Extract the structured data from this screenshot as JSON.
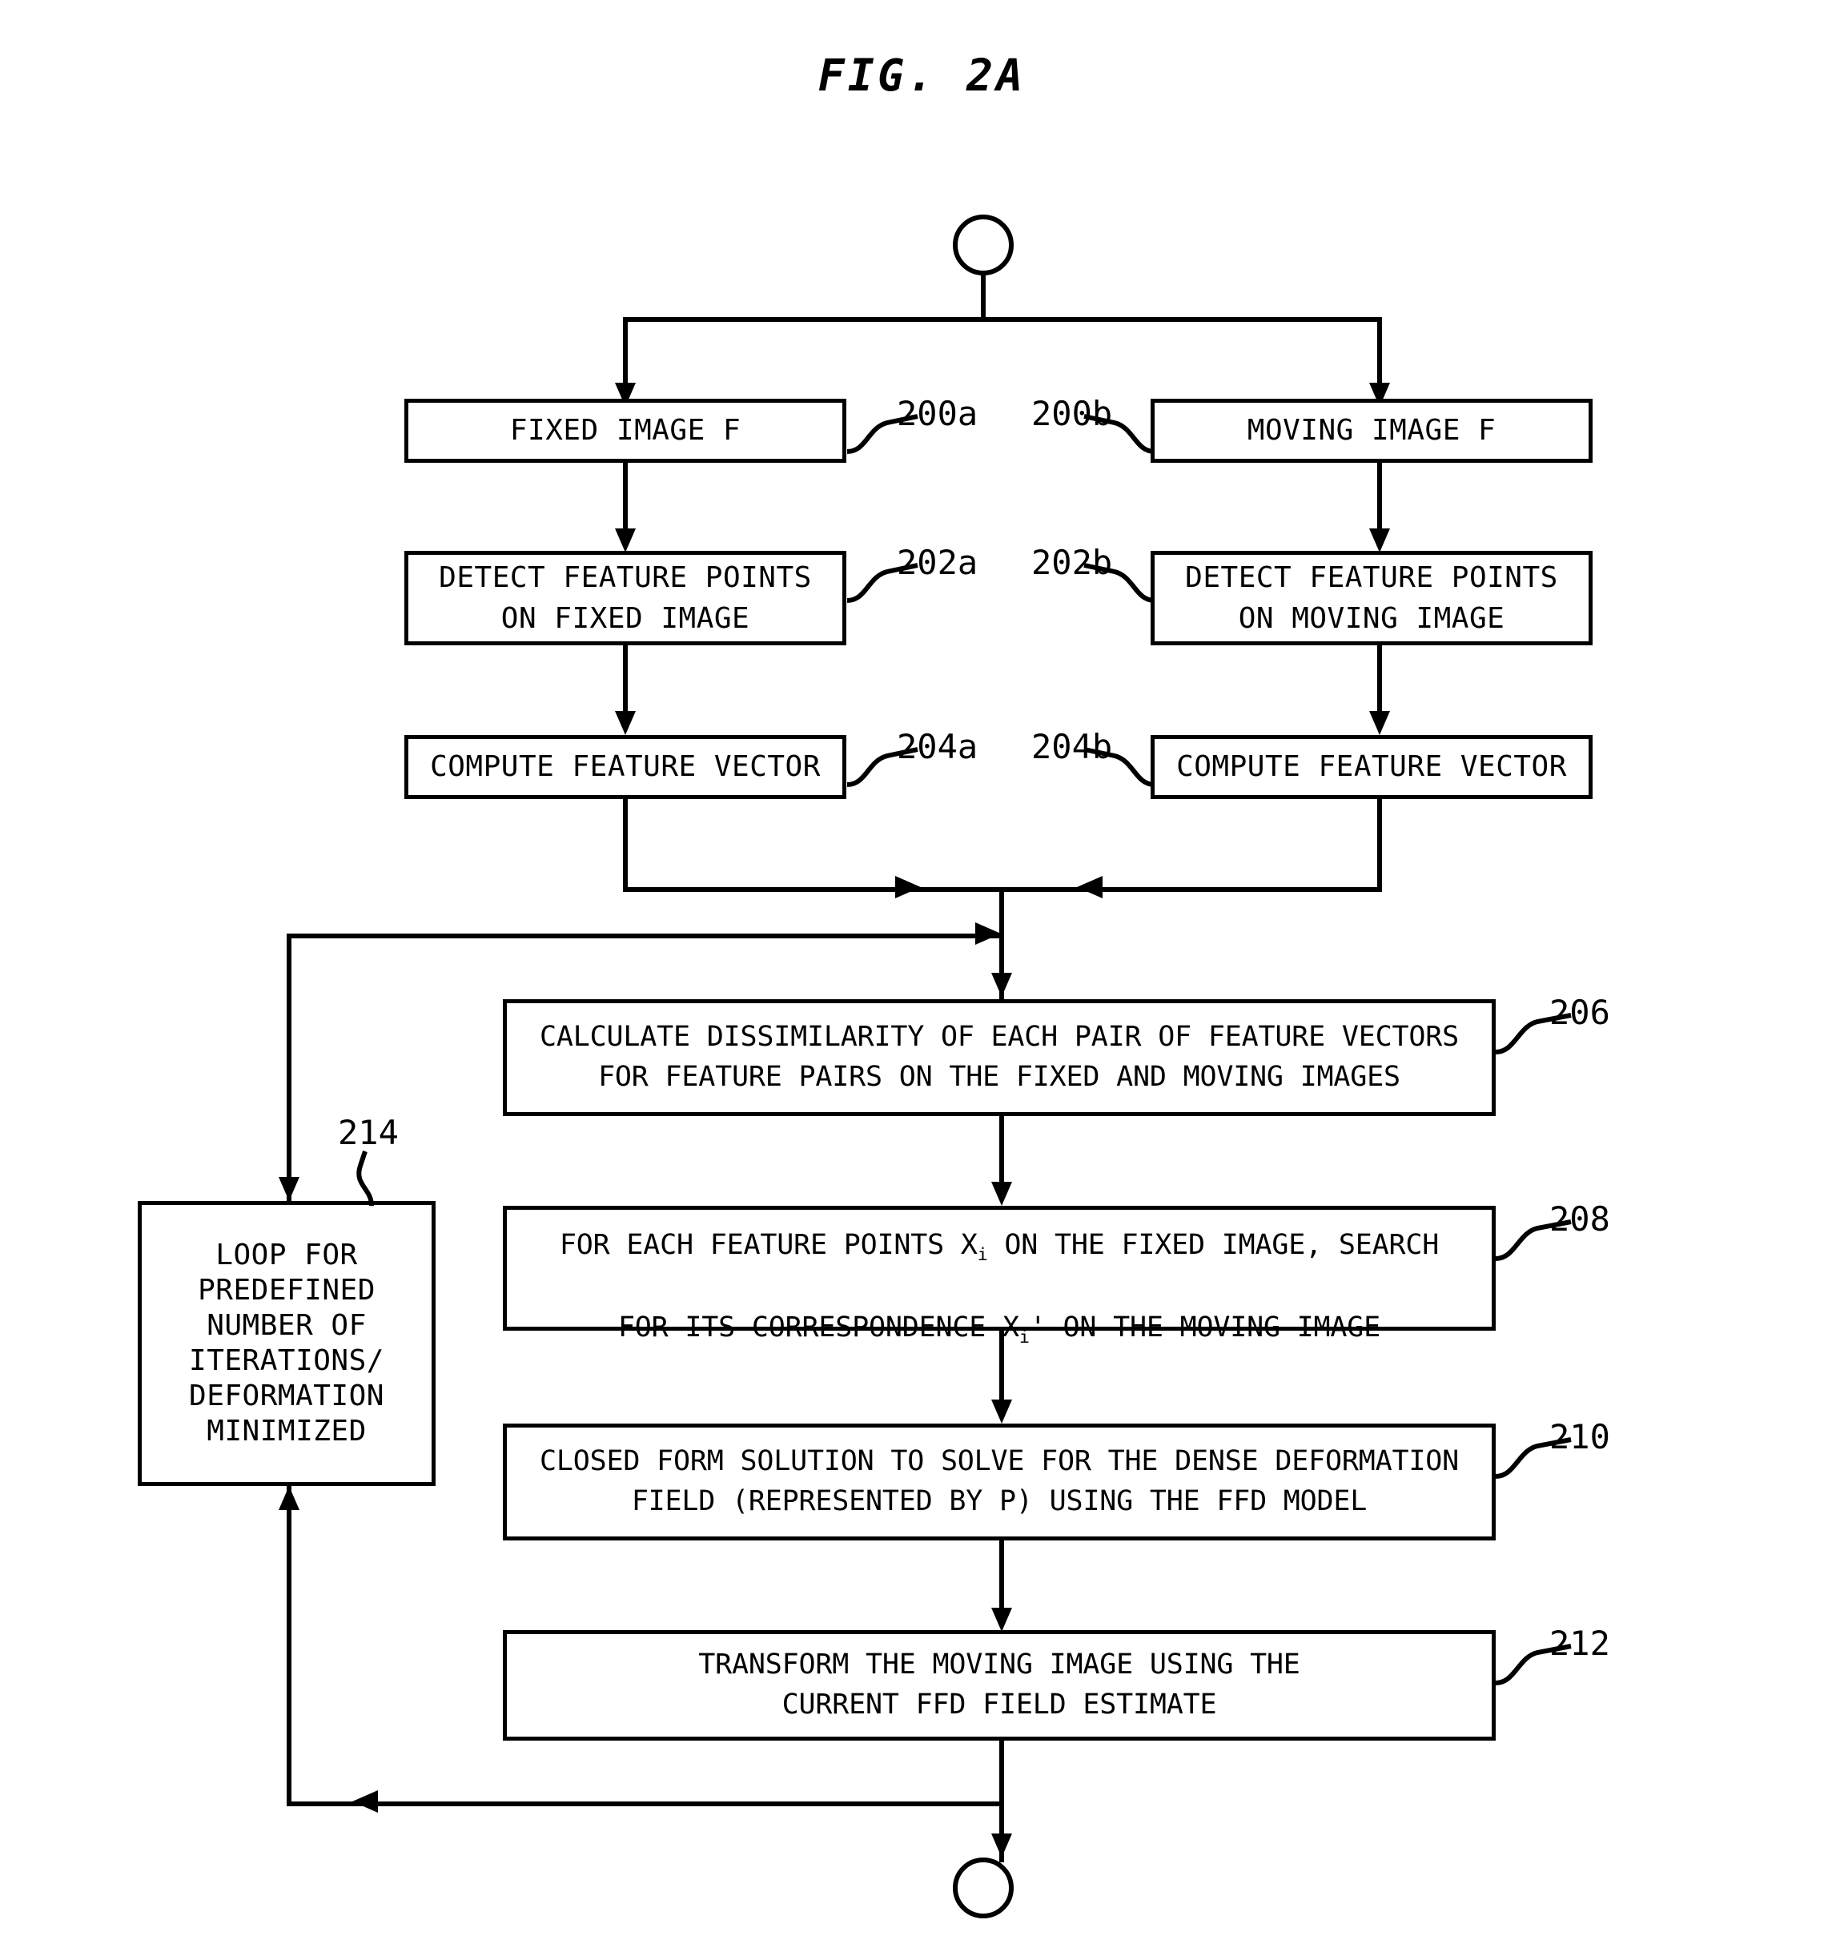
{
  "figure": {
    "title": "FIG. 2A"
  },
  "nodes": {
    "start": {
      "name": "start-terminator",
      "label": ""
    },
    "end": {
      "name": "end-terminator",
      "label": ""
    },
    "fixed_image": {
      "text": "FIXED IMAGE F",
      "ref": "200a"
    },
    "moving_image": {
      "text": "MOVING IMAGE F",
      "ref": "200b"
    },
    "detect_fixed": {
      "line1": "DETECT FEATURE POINTS",
      "line2": "ON FIXED IMAGE",
      "ref": "202a"
    },
    "detect_moving": {
      "line1": "DETECT FEATURE POINTS",
      "line2": "ON MOVING IMAGE",
      "ref": "202b"
    },
    "compute_vector_fixed": {
      "text": "COMPUTE FEATURE VECTOR",
      "ref": "204a"
    },
    "compute_vector_moving": {
      "text": "COMPUTE FEATURE VECTOR",
      "ref": "204b"
    },
    "calculate_dissimilarity": {
      "line1": "CALCULATE DISSIMILARITY OF EACH PAIR OF FEATURE VECTORS",
      "line2": "FOR FEATURE PAIRS ON THE FIXED AND MOVING IMAGES",
      "ref": "206"
    },
    "search_correspondence": {
      "line1_a": "FOR EACH FEATURE POINTS X",
      "line1_sub": "i",
      "line1_b": " ON THE FIXED IMAGE, SEARCH",
      "line2_a": "FOR ITS CORRESPONDENCE X",
      "line2_sub": "i",
      "line2_b": "' ON THE MOVING IMAGE",
      "ref": "208"
    },
    "closed_form": {
      "line1": "CLOSED FORM SOLUTION TO SOLVE FOR THE DENSE DEFORMATION",
      "line2": "FIELD (REPRESENTED BY P) USING THE FFD MODEL",
      "ref": "210"
    },
    "transform": {
      "line1": "TRANSFORM THE MOVING IMAGE USING THE",
      "line2": "CURRENT FFD FIELD ESTIMATE",
      "ref": "212"
    },
    "loop": {
      "line1": "LOOP FOR",
      "line2": "PREDEFINED",
      "line3": "NUMBER OF",
      "line4": "ITERATIONS/",
      "line5": "DEFORMATION",
      "line6": "MINIMIZED",
      "ref": "214"
    }
  },
  "colors": {
    "ink": "#000000",
    "paper": "#ffffff"
  }
}
